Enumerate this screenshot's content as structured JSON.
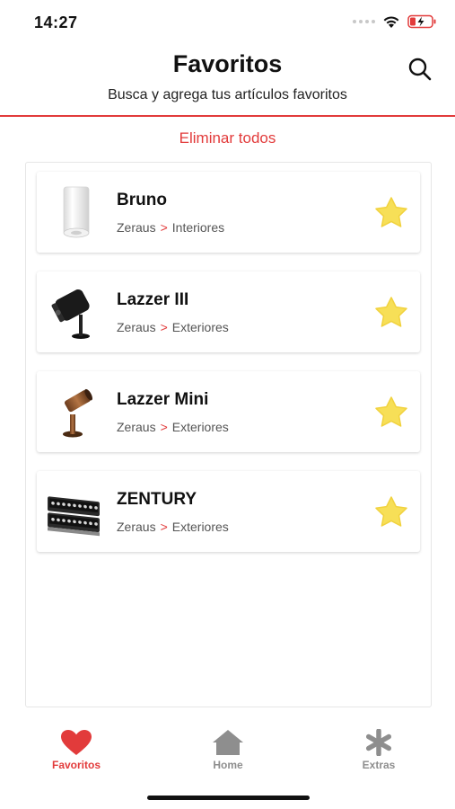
{
  "status_bar": {
    "time": "14:27"
  },
  "header": {
    "title": "Favoritos",
    "subtitle": "Busca y agrega tus artículos favoritos"
  },
  "actions": {
    "delete_all_label": "Eliminar todos"
  },
  "favorites": [
    {
      "name": "Bruno",
      "brand": "Zeraus",
      "separator": ">",
      "category": "Interiores",
      "thumb_icon": "white-cylinder-lamp-icon",
      "starred": true
    },
    {
      "name": "Lazzer III",
      "brand": "Zeraus",
      "separator": ">",
      "category": "Exteriores",
      "thumb_icon": "black-spotlight-icon",
      "starred": true
    },
    {
      "name": "Lazzer Mini",
      "brand": "Zeraus",
      "separator": ">",
      "category": "Exteriores",
      "thumb_icon": "bronze-mini-spotlight-icon",
      "starred": true
    },
    {
      "name": "ZENTURY",
      "brand": "Zeraus",
      "separator": ">",
      "category": "Exteriores",
      "thumb_icon": "led-floodlight-icon",
      "starred": true
    }
  ],
  "tabs": [
    {
      "label": "Favoritos",
      "icon": "heart-icon",
      "active": true
    },
    {
      "label": "Home",
      "icon": "home-icon",
      "active": false
    },
    {
      "label": "Extras",
      "icon": "asterisk-icon",
      "active": false
    }
  ],
  "colors": {
    "accent": "#e23b3b",
    "star": "#f7df57",
    "inactive_tab": "#8e8e8e"
  }
}
